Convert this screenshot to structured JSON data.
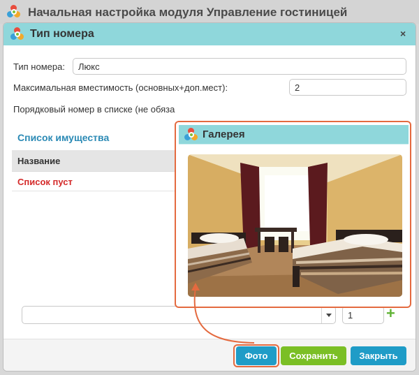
{
  "window": {
    "title": "Начальная настройка модуля Управление гостиницей"
  },
  "dialog": {
    "title": "Тип номера",
    "close_icon": "×"
  },
  "form": {
    "room_type_label": "Тип номера:",
    "room_type_value": "Люкс",
    "capacity_label": "Максимальная вместимость (основных+доп.мест):",
    "capacity_value": "2",
    "order_label": "Порядковый номер в списке (не обяза"
  },
  "property_list": {
    "title": "Список имущества",
    "column_name": "Название",
    "empty_text": "Список пуст"
  },
  "bottom_row": {
    "select_value": "",
    "quantity_value": "1",
    "add_icon": "+"
  },
  "buttons": {
    "photo": "Фото",
    "save": "Сохранить",
    "close": "Закрыть"
  },
  "gallery": {
    "title": "Галерея"
  },
  "colors": {
    "header_accent": "#8fd7db",
    "highlight": "#e46a3f",
    "link_blue": "#2b8ab5",
    "empty_red": "#d42a2a",
    "primary_button": "#1f9cc7",
    "save_button": "#7bbf25",
    "trash_button": "#ef6530"
  }
}
